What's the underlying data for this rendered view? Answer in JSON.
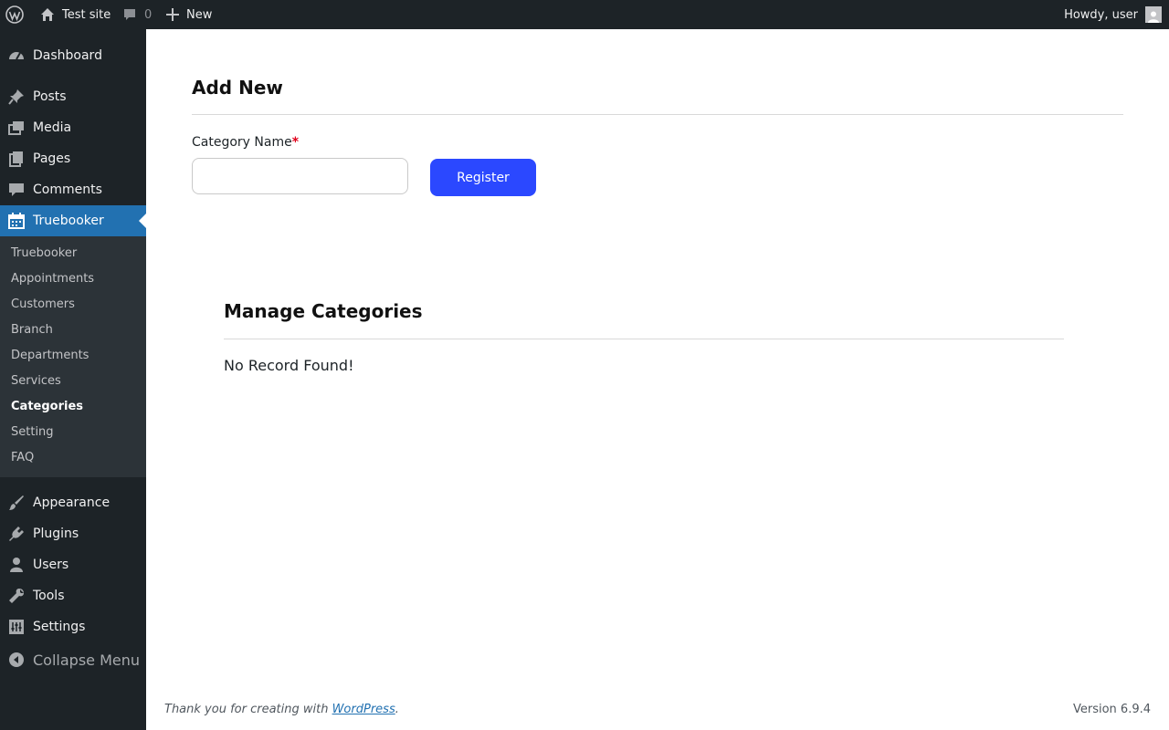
{
  "adminbar": {
    "site_name": "Test site",
    "comment_count": "0",
    "new_label": "New",
    "howdy": "Howdy, user"
  },
  "sidebar": {
    "items": [
      {
        "label": "Dashboard",
        "icon": "dashboard-icon"
      },
      {
        "label": "Posts",
        "icon": "pin-icon"
      },
      {
        "label": "Media",
        "icon": "media-icon"
      },
      {
        "label": "Pages",
        "icon": "pages-icon"
      },
      {
        "label": "Comments",
        "icon": "comment-icon"
      },
      {
        "label": "Truebooker",
        "icon": "calendar-icon"
      },
      {
        "label": "Appearance",
        "icon": "brush-icon"
      },
      {
        "label": "Plugins",
        "icon": "plug-icon"
      },
      {
        "label": "Users",
        "icon": "user-icon"
      },
      {
        "label": "Tools",
        "icon": "wrench-icon"
      },
      {
        "label": "Settings",
        "icon": "settings-icon"
      }
    ],
    "submenu": [
      "Truebooker",
      "Appointments",
      "Customers",
      "Branch",
      "Departments",
      "Services",
      "Categories",
      "Setting",
      "FAQ"
    ],
    "collapse_label": "Collapse Menu"
  },
  "main": {
    "add_title": "Add New",
    "category_label": "Category Name",
    "required_mark": "*",
    "category_value": "",
    "register_label": "Register",
    "manage_title": "Manage Categories",
    "empty_message": "No Record Found!"
  },
  "footer": {
    "thanks_prefix": "Thank you for creating with ",
    "thanks_link": "WordPress",
    "thanks_suffix": ".",
    "version": "Version 6.9.4"
  },
  "colors": {
    "sidebar_bg": "#1d2327",
    "submenu_bg": "#2c3338",
    "active_blue": "#2271b1",
    "register_blue": "#2b48ff",
    "required_red": "#e0001b"
  }
}
